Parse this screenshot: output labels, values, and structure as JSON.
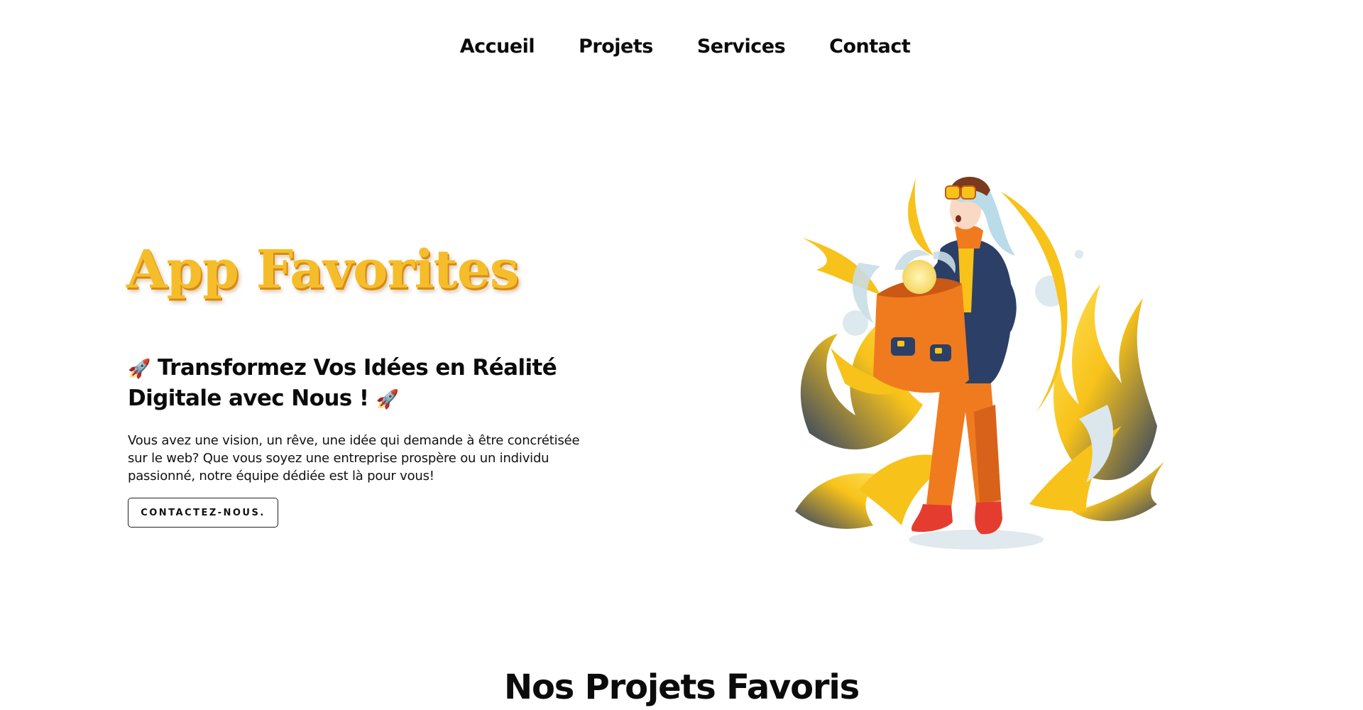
{
  "nav": {
    "items": [
      {
        "label": "Accueil"
      },
      {
        "label": "Projets"
      },
      {
        "label": "Services"
      },
      {
        "label": "Contact"
      }
    ]
  },
  "hero": {
    "logo_text": "App Favorites",
    "rocket_emoji": "🚀",
    "headline": "Transformez Vos Idées en Réalité Digitale avec Nous !",
    "paragraph": "Vous avez une vision, un rêve, une idée qui demande à être concrétisée sur le web? Que vous soyez une entreprise prospère ou un individu passionné, notre équipe dédiée est là pour vous!",
    "cta_label": "CONTACTEZ-NOUS.",
    "illustration_icon": "person-with-glowing-bag-illustration"
  },
  "projects": {
    "title": "Nos Projets Favoris"
  },
  "colors": {
    "logo_yellow": "#f6bd2b",
    "text": "#0b0b0b",
    "accent_orange": "#f07a1e",
    "accent_navy": "#2c3f66"
  }
}
